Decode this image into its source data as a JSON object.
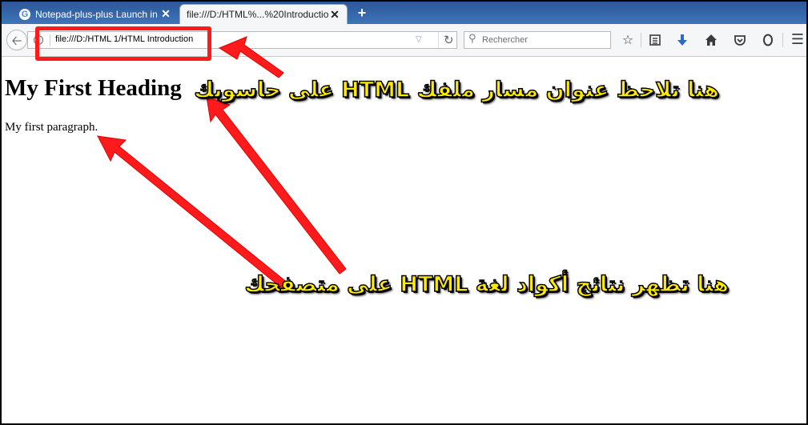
{
  "tabs": [
    {
      "label": "Notepad-plus-plus Launch in f...",
      "active": false,
      "icon": "google-g-icon",
      "icon_glyph": "G"
    },
    {
      "label": "file:///D:/HTML%...%20Introduction",
      "active": true
    }
  ],
  "tab_close_glyph": "✕",
  "new_tab_glyph": "+",
  "navbar": {
    "url": "file:///D:/HTML 1/HTML Introduction",
    "search_placeholder": "Rechercher"
  },
  "page": {
    "heading": "My First Heading",
    "paragraph": "My first paragraph."
  },
  "annotations": {
    "top": "هنا تلاحظ عنوان مسار ملفك HTML على حاسوبك",
    "bottom": "هنا تظهر نتائج أكواد لغة HTML على متصفحك"
  },
  "colors": {
    "annotation_text": "#ffea00",
    "annotation_box": "#ff1b1b",
    "arrow": "#ff1b1b",
    "tabstrip": "#2b5797"
  }
}
